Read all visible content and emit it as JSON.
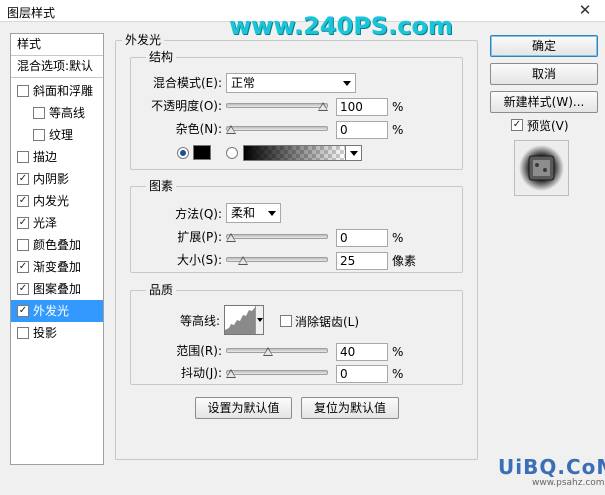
{
  "window": {
    "title": "图层样式",
    "close_glyph": "✕"
  },
  "watermark": {
    "text": "www.240PS.com",
    "color": "#19c6d9"
  },
  "styles_list": {
    "header": "样式",
    "blend_options": "混合选项:默认",
    "items": [
      {
        "label": "斜面和浮雕",
        "checked": false,
        "indent": false
      },
      {
        "label": "等高线",
        "checked": false,
        "indent": true
      },
      {
        "label": "纹理",
        "checked": false,
        "indent": true
      },
      {
        "label": "描边",
        "checked": false,
        "indent": false
      },
      {
        "label": "内阴影",
        "checked": true,
        "indent": false
      },
      {
        "label": "内发光",
        "checked": true,
        "indent": false
      },
      {
        "label": "光泽",
        "checked": true,
        "indent": false
      },
      {
        "label": "颜色叠加",
        "checked": false,
        "indent": false
      },
      {
        "label": "渐变叠加",
        "checked": true,
        "indent": false
      },
      {
        "label": "图案叠加",
        "checked": true,
        "indent": false
      },
      {
        "label": "外发光",
        "checked": true,
        "indent": false,
        "selected": true
      },
      {
        "label": "投影",
        "checked": false,
        "indent": false
      }
    ],
    "selected_color": "#3399ff"
  },
  "outer_glow": {
    "title": "外发光",
    "structure": {
      "legend": "结构",
      "blend_mode_label": "混合模式(E):",
      "blend_mode_value": "正常",
      "opacity_label": "不透明度(O):",
      "opacity_value": "100",
      "opacity_unit": "%",
      "noise_label": "杂色(N):",
      "noise_value": "0",
      "noise_unit": "%",
      "color_mode": "solid",
      "glow_color": "#000000"
    },
    "elements": {
      "legend": "图素",
      "technique_label": "方法(Q):",
      "technique_value": "柔和",
      "spread_label": "扩展(P):",
      "spread_value": "0",
      "spread_unit": "%",
      "size_label": "大小(S):",
      "size_value": "25",
      "size_unit": "像素"
    },
    "quality": {
      "legend": "品质",
      "contour_label": "等高线:",
      "antialias_label": "消除锯齿(L)",
      "antialias_checked": false,
      "range_label": "范围(R):",
      "range_value": "40",
      "range_unit": "%",
      "jitter_label": "抖动(J):",
      "jitter_value": "0",
      "jitter_unit": "%"
    },
    "set_default": "设置为默认值",
    "reset_default": "复位为默认值"
  },
  "buttons": {
    "ok": "确定",
    "cancel": "取消",
    "new_style": "新建样式(W)...",
    "preview_label": "预览(V)",
    "preview_checked": true
  },
  "brand_logo": {
    "text": "UiBQ.CoM",
    "subtext": "www.psahz.com"
  }
}
